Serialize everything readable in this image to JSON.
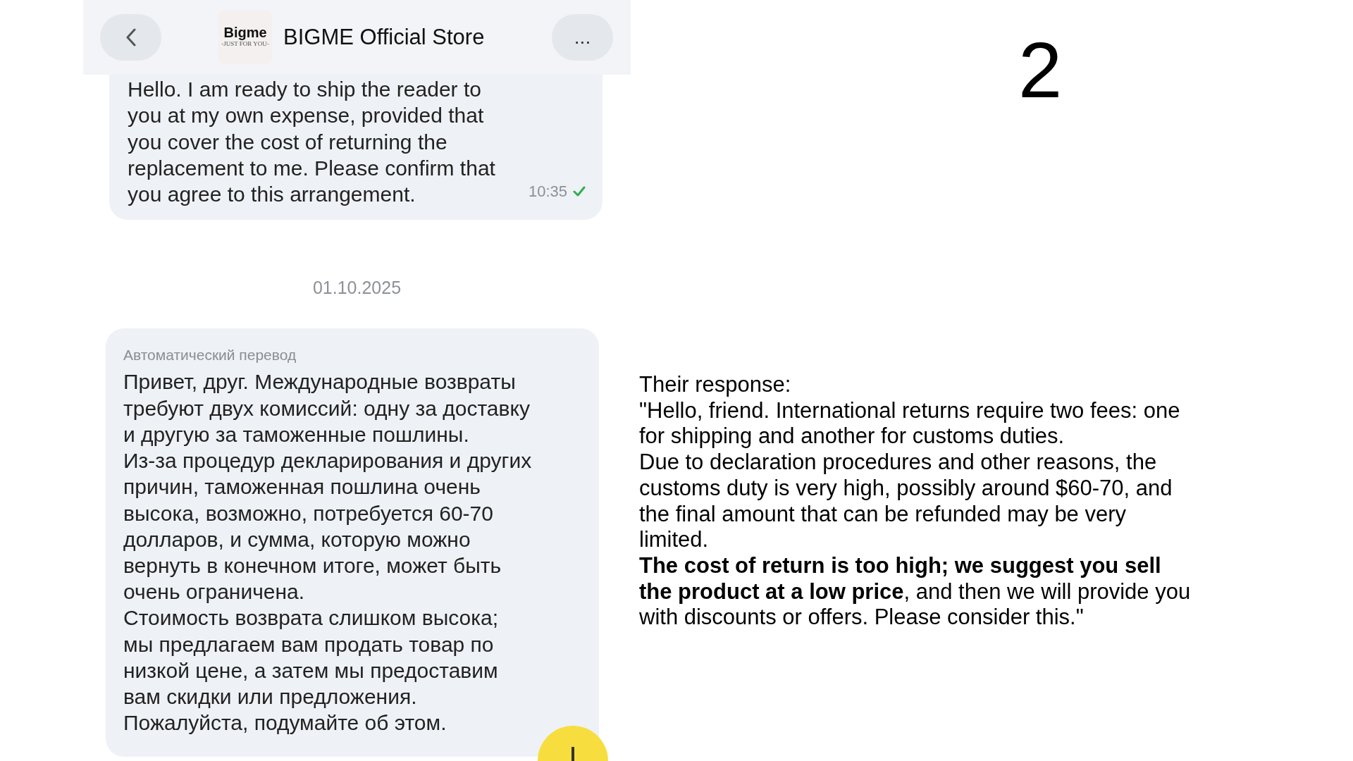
{
  "chat": {
    "header": {
      "logo_text": "Bigme",
      "logo_tagline": "-JUST FOR YOU-",
      "title": "BIGME Official Store",
      "more_label": "..."
    },
    "messages": [
      {
        "kind": "outgoing",
        "paragraphs": [
          "Hello. I am ready to ship the reader to you at my own expense, provided that you cover the cost of returning the replacement to me. Please confirm that you agree to this arrangement."
        ],
        "time": "10:35",
        "read": true
      },
      {
        "kind": "date",
        "text": "01.10.2025"
      },
      {
        "kind": "incoming",
        "label": "Автоматический перевод",
        "paragraphs": [
          "Привет, друг. Международные возвраты требуют двух комиссий: одну за доставку и другую за таможенные пошлины.",
          "Из-за процедур декларирования и других причин, таможенная пошлина очень высока, возможно, потребуется 60-70 долларов, и сумма, которую можно вернуть в конечном итоге, может быть очень ограничена.",
          "Стоимость возврата слишком высока; мы предлагаем вам продать товар по низкой цене, а затем мы предоставим вам скидки или предложения.",
          "Пожалуйста, подумайте об этом."
        ]
      }
    ]
  },
  "annotation": {
    "number": "2",
    "heading": "Their response:",
    "paragraphs": [
      "\"Hello, friend. International returns require two fees: one for shipping and another for customs duties.",
      "Due to declaration procedures and other reasons, the customs duty is very high, possibly around $60-70, and the final amount that can be refunded may be very limited.",
      "**The cost of return is too high; we suggest you sell the product at a low price**, and then we will provide you with discounts or offers. Please consider this.\""
    ]
  }
}
